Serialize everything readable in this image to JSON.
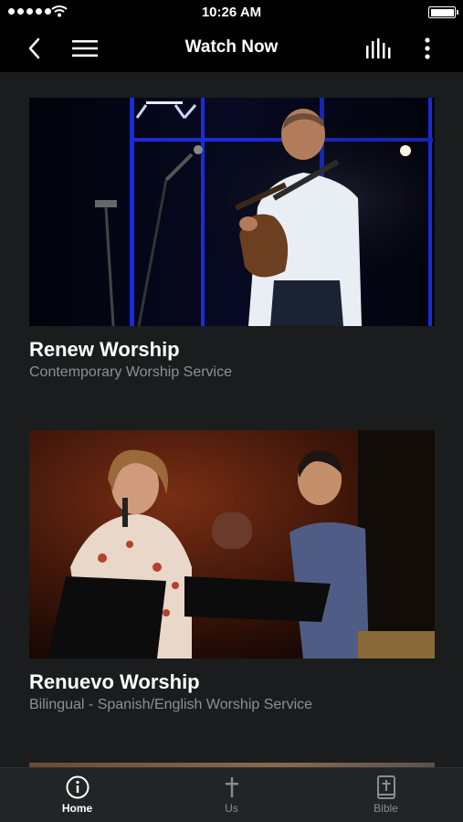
{
  "status_bar": {
    "time": "10:26 AM",
    "battery_level": 1.0
  },
  "nav": {
    "title": "Watch Now",
    "back_icon": "chevron-left-icon",
    "menu_icon": "hamburger-icon",
    "audio_icon": "equalizer-icon",
    "more_icon": "vertical-ellipsis-icon"
  },
  "cards": [
    {
      "title": "Renew Worship",
      "subtitle": "Contemporary Worship Service"
    },
    {
      "title": "Renuevo Worship",
      "subtitle": "Bilingual - Spanish/English Worship Service"
    }
  ],
  "tabs": [
    {
      "label": "Home",
      "icon": "info-circle-icon",
      "active": true
    },
    {
      "label": "Us",
      "icon": "cross-icon",
      "active": false
    },
    {
      "label": "Bible",
      "icon": "bible-icon",
      "active": false
    }
  ],
  "colors": {
    "background": "#1b1c1e",
    "bar": "#000000",
    "tab_bar": "#232427",
    "muted_text": "#8d8f93"
  }
}
